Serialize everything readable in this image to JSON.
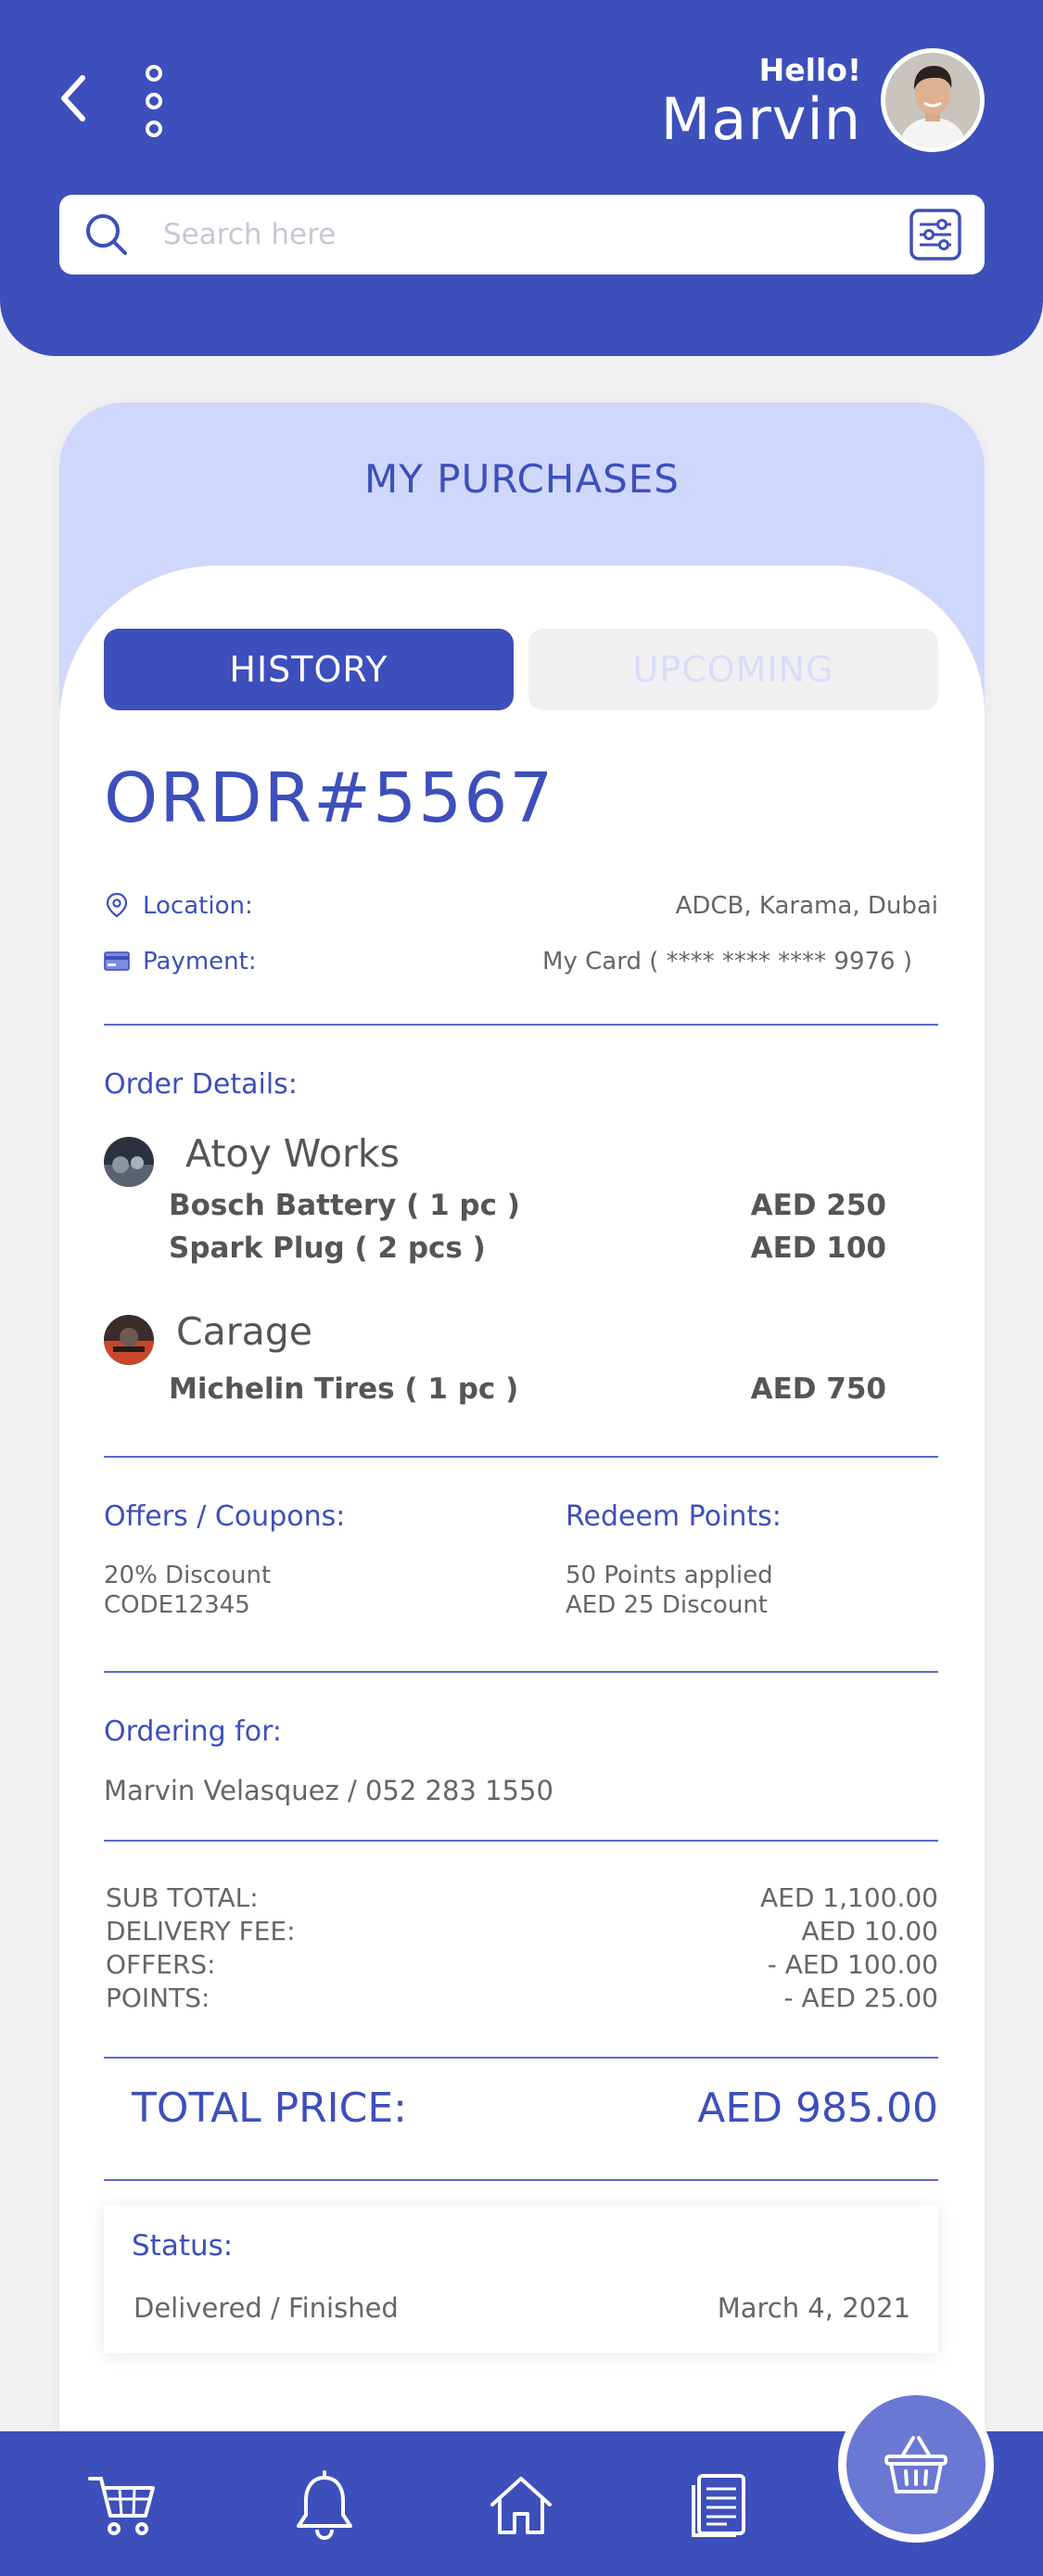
{
  "header": {
    "greeting": "Hello!",
    "user_name": "Marvin",
    "search_placeholder": "Search here"
  },
  "card": {
    "title": "MY PURCHASES",
    "tabs": [
      {
        "label": "HISTORY",
        "active": true
      },
      {
        "label": "UPCOMING",
        "active": false
      }
    ]
  },
  "order": {
    "id": "ORDR#5567",
    "location_label": "Location:",
    "location_value": "ADCB, Karama, Dubai",
    "payment_label": "Payment:",
    "payment_value": "My Card ( **** **** **** 9976 )"
  },
  "details": {
    "label": "Order Details:",
    "stores": [
      {
        "name": "Atoy Works",
        "items": [
          {
            "name": "Bosch Battery  ( 1 pc )",
            "price": "AED 250"
          },
          {
            "name": "Spark Plug  ( 2 pcs )",
            "price": "AED 100"
          }
        ]
      },
      {
        "name": "Carage",
        "items": [
          {
            "name": "Michelin Tires  ( 1 pc )",
            "price": "AED 750"
          }
        ]
      }
    ]
  },
  "offers": {
    "label": "Offers / Coupons:",
    "line1": "20% Discount",
    "line2": "CODE12345"
  },
  "redeem": {
    "label": "Redeem Points:",
    "line1": "50 Points applied",
    "line2": "AED 25 Discount"
  },
  "ordering_for": {
    "label": "Ordering for:",
    "value": "Marvin Velasquez / 052 283 1550"
  },
  "summary": [
    {
      "label": "SUB TOTAL:",
      "value": "AED 1,100.00"
    },
    {
      "label": "DELIVERY FEE:",
      "value": "AED 10.00"
    },
    {
      "label": "OFFERS:",
      "value": "- AED 100.00"
    },
    {
      "label": "POINTS:",
      "value": "- AED 25.00"
    }
  ],
  "total": {
    "label": "TOTAL PRICE:",
    "value": "AED 985.00"
  },
  "status": {
    "label": "Status:",
    "value": "Delivered / Finished",
    "date": "March 4, 2021"
  },
  "colors": {
    "primary": "#3d4fbb",
    "lavender": "#cfd7fb",
    "fab": "#6a78d4"
  },
  "nav_icons": [
    "cart-icon",
    "bell-icon",
    "home-icon",
    "receipt-icon",
    "basket-icon"
  ]
}
